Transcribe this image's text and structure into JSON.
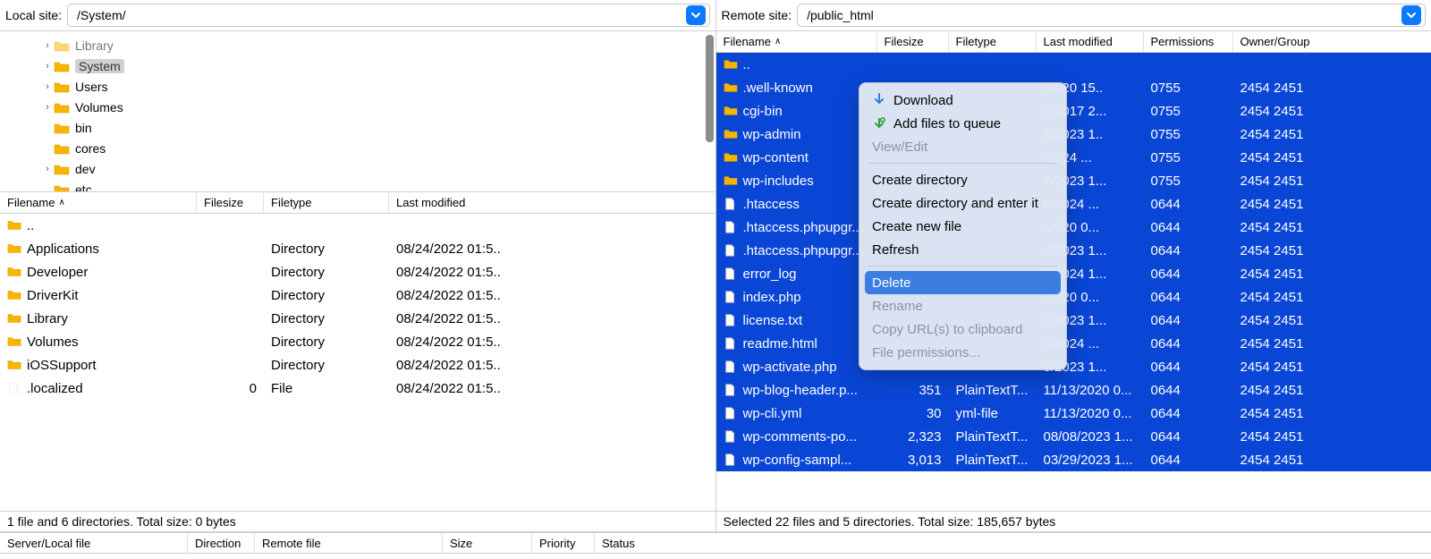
{
  "local": {
    "label": "Local site:",
    "path": "/System/",
    "tree": [
      {
        "name": "Library",
        "depth": 2,
        "expandable": true,
        "selected": false,
        "cut": true
      },
      {
        "name": "System",
        "depth": 2,
        "expandable": true,
        "selected": true
      },
      {
        "name": "Users",
        "depth": 2,
        "expandable": true,
        "selected": false
      },
      {
        "name": "Volumes",
        "depth": 2,
        "expandable": true,
        "selected": false
      },
      {
        "name": "bin",
        "depth": 2,
        "expandable": false,
        "selected": false
      },
      {
        "name": "cores",
        "depth": 2,
        "expandable": false,
        "selected": false
      },
      {
        "name": "dev",
        "depth": 2,
        "expandable": true,
        "selected": false
      },
      {
        "name": "etc",
        "depth": 2,
        "expandable": false,
        "selected": false
      }
    ],
    "columns": {
      "filename": "Filename",
      "filesize": "Filesize",
      "filetype": "Filetype",
      "lastmod": "Last modified"
    },
    "rows": [
      {
        "name": "..",
        "icon": "folder",
        "size": "",
        "type": "",
        "mod": ""
      },
      {
        "name": "Applications",
        "icon": "folder",
        "size": "",
        "type": "Directory",
        "mod": "08/24/2022 01:5.."
      },
      {
        "name": "Developer",
        "icon": "folder",
        "size": "",
        "type": "Directory",
        "mod": "08/24/2022 01:5.."
      },
      {
        "name": "DriverKit",
        "icon": "folder",
        "size": "",
        "type": "Directory",
        "mod": "08/24/2022 01:5.."
      },
      {
        "name": "Library",
        "icon": "folder",
        "size": "",
        "type": "Directory",
        "mod": "08/24/2022 01:5.."
      },
      {
        "name": "Volumes",
        "icon": "folder",
        "size": "",
        "type": "Directory",
        "mod": "08/24/2022 01:5.."
      },
      {
        "name": "iOSSupport",
        "icon": "folder",
        "size": "",
        "type": "Directory",
        "mod": "08/24/2022 01:5.."
      },
      {
        "name": ".localized",
        "icon": "file-blank",
        "size": "0",
        "type": "File",
        "mod": "08/24/2022 01:5.."
      }
    ],
    "status": "1 file and 6 directories. Total size: 0 bytes"
  },
  "remote": {
    "label": "Remote site:",
    "path": "/public_html",
    "columns": {
      "filename": "Filename",
      "filesize": "Filesize",
      "filetype": "Filetype",
      "lastmod": "Last modified",
      "perm": "Permissions",
      "owner": "Owner/Group"
    },
    "rows": [
      {
        "name": "..",
        "icon": "folder",
        "size": "",
        "type": "",
        "mod": "",
        "perm": "",
        "owner": ""
      },
      {
        "name": ".well-known",
        "icon": "folder",
        "size": "",
        "type": "",
        "mod": "/2020 15..",
        "perm": "0755",
        "owner": "2454 2451"
      },
      {
        "name": "cgi-bin",
        "icon": "folder",
        "size": "",
        "type": "",
        "mod": "2/2017 2...",
        "perm": "0755",
        "owner": "2454 2451"
      },
      {
        "name": "wp-admin",
        "icon": "folder",
        "size": "",
        "type": "",
        "mod": "8/2023 1..",
        "perm": "0755",
        "owner": "2454 2451"
      },
      {
        "name": "wp-content",
        "icon": "folder",
        "size": "",
        "type": "",
        "mod": "/2024 ...",
        "perm": "0755",
        "owner": "2454 2451"
      },
      {
        "name": "wp-includes",
        "icon": "folder",
        "size": "",
        "type": "",
        "mod": "7/2023 1...",
        "perm": "0755",
        "owner": "2454 2451"
      },
      {
        "name": ".htaccess",
        "icon": "file",
        "size": "",
        "type": "",
        "mod": "8/2024 ...",
        "perm": "0644",
        "owner": "2454 2451"
      },
      {
        "name": ".htaccess.phpupgr...",
        "icon": "file",
        "size": "",
        "type": "",
        "mod": "/2020 0...",
        "perm": "0644",
        "owner": "2454 2451"
      },
      {
        "name": ".htaccess.phpupgr...",
        "icon": "file",
        "size": "",
        "type": "",
        "mod": "7/2023 1...",
        "perm": "0644",
        "owner": "2454 2451"
      },
      {
        "name": "error_log",
        "icon": "file",
        "size": "",
        "type": "",
        "mod": "7/2024 1...",
        "perm": "0644",
        "owner": "2454 2451"
      },
      {
        "name": "index.php",
        "icon": "file",
        "size": "",
        "type": "",
        "mod": "/2020 0...",
        "perm": "0644",
        "owner": "2454 2451"
      },
      {
        "name": "license.txt",
        "icon": "file",
        "size": "",
        "type": "",
        "mod": "7/2023 1...",
        "perm": "0644",
        "owner": "2454 2451"
      },
      {
        "name": "readme.html",
        "icon": "file",
        "size": "",
        "type": "",
        "mod": "0/2024 ...",
        "perm": "0644",
        "owner": "2454 2451"
      },
      {
        "name": "wp-activate.php",
        "icon": "file",
        "size": "",
        "type": "",
        "mod": "8/2023 1...",
        "perm": "0644",
        "owner": "2454 2451"
      },
      {
        "name": "wp-blog-header.p...",
        "icon": "file",
        "size": "351",
        "type": "PlainTextT...",
        "mod": "11/13/2020 0...",
        "perm": "0644",
        "owner": "2454 2451"
      },
      {
        "name": "wp-cli.yml",
        "icon": "file",
        "size": "30",
        "type": "yml-file",
        "mod": "11/13/2020 0...",
        "perm": "0644",
        "owner": "2454 2451"
      },
      {
        "name": "wp-comments-po...",
        "icon": "file",
        "size": "2,323",
        "type": "PlainTextT...",
        "mod": "08/08/2023 1...",
        "perm": "0644",
        "owner": "2454 2451"
      },
      {
        "name": "wp-config-sampl...",
        "icon": "file",
        "size": "3,013",
        "type": "PlainTextT...",
        "mod": "03/29/2023 1...",
        "perm": "0644",
        "owner": "2454 2451"
      }
    ],
    "status": "Selected 22 files and 5 directories. Total size: 185,657 bytes"
  },
  "context_menu": {
    "download": "Download",
    "add_queue": "Add files to queue",
    "view_edit": "View/Edit",
    "create_dir": "Create directory",
    "create_dir_enter": "Create directory and enter it",
    "create_file": "Create new file",
    "refresh": "Refresh",
    "delete": "Delete",
    "rename": "Rename",
    "copy_url": "Copy URL(s) to clipboard",
    "file_perm": "File permissions..."
  },
  "queue_cols": {
    "file": "Server/Local file",
    "dir": "Direction",
    "remote": "Remote file",
    "size": "Size",
    "priority": "Priority",
    "status": "Status"
  }
}
